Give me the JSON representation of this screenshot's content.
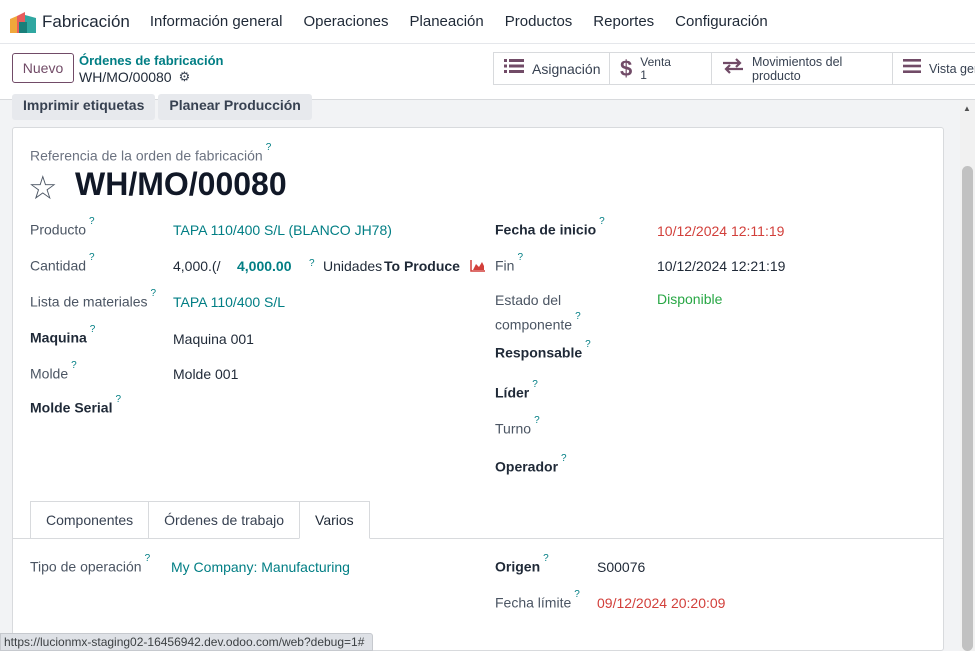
{
  "app": {
    "name": "Fabricación",
    "menu": [
      "Información general",
      "Operaciones",
      "Planeación",
      "Productos",
      "Reportes",
      "Configuración"
    ]
  },
  "control": {
    "new_label": "Nuevo",
    "breadcrumb_parent": "Órdenes de fabricación",
    "breadcrumb_current": "WH/MO/00080"
  },
  "smart_buttons": {
    "assignment": "Asignación",
    "sale_label": "Venta",
    "sale_count": "1",
    "moves": "Movimientos del producto",
    "overview": "Vista gen"
  },
  "actions": {
    "print_labels": "Imprimir etiquetas",
    "plan_production": "Planear Producción"
  },
  "form": {
    "ref_label": "Referencia de la orden de fabricación",
    "ref_value": "WH/MO/00080",
    "left": {
      "product_label": "Producto",
      "product_value": "TAPA 110/400 S/L (BLANCO JH78)",
      "qty_label": "Cantidad",
      "qty_produced": "4,000.(/",
      "qty_target": "4,000.00",
      "qty_unit": "Unidades",
      "qty_to_produce": "To Produce",
      "bom_label": "Lista de materiales",
      "bom_value": "TAPA 110/400 S/L",
      "machine_label": "Maquina",
      "machine_value": "Maquina 001",
      "mold_label": "Molde",
      "mold_value": "Molde 001",
      "mold_serial_label": "Molde Serial"
    },
    "right": {
      "start_label": "Fecha de inicio",
      "start_value": "10/12/2024 12:11:19",
      "end_label": "Fin",
      "end_value": "10/12/2024 12:21:19",
      "component_status_label_1": "Estado del",
      "component_status_label_2": "componente",
      "component_status_value": "Disponible",
      "responsible_label": "Responsable",
      "leader_label": "Líder",
      "shift_label": "Turno",
      "operator_label": "Operador"
    }
  },
  "tabs": [
    "Componentes",
    "Órdenes de trabajo",
    "Varios"
  ],
  "misc": {
    "op_type_label": "Tipo de operación",
    "op_type_value": "My Company: Manufacturing",
    "origin_label": "Origen",
    "origin_value": "S00076",
    "deadline_label": "Fecha límite",
    "deadline_value": "09/12/2024 20:20:09"
  },
  "status_url": "https://lucionmx-staging02-16456942.dev.odoo.com/web?debug=1#",
  "colors": {
    "brand": "#714b67",
    "link": "#017e84",
    "danger": "#d23f3a",
    "success": "#28a745"
  },
  "icons": {
    "app_logo": "odoo-manufacturing-logo",
    "assignment": "list-icon",
    "sale": "dollar-icon",
    "moves": "arrows-exchange-icon",
    "overview": "menu-lines-icon",
    "settings": "gear-icon",
    "favorite": "star-icon",
    "forecast": "area-chart-icon"
  }
}
